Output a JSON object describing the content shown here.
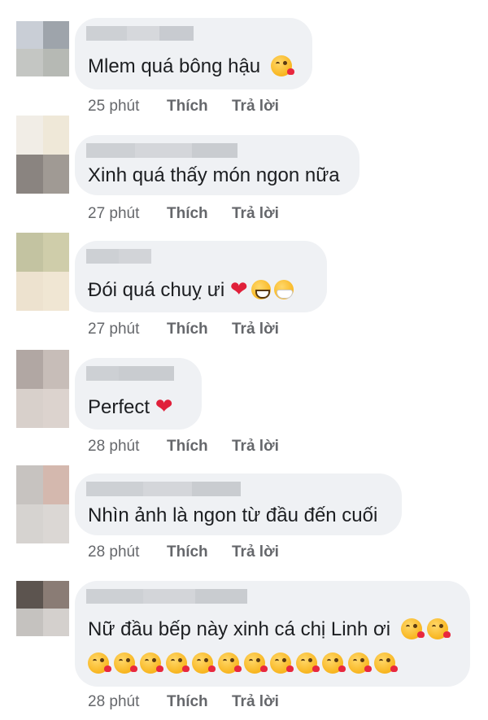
{
  "comments": [
    {
      "text": "Mlem quá bông hậu",
      "time": "25 phút",
      "like": "Thích",
      "reply": "Trả lời",
      "avatar_colors": [
        "#c9ced6",
        "#9ea4ab",
        "#c4c6c3",
        "#b6b9b4"
      ]
    },
    {
      "text": "Xinh quá thấy món ngon nữa",
      "time": "27 phút",
      "like": "Thích",
      "reply": "Trả lời",
      "avatar_colors": [
        "#f1ede6",
        "#efe8d8",
        "#8a8480",
        "#a09a94"
      ]
    },
    {
      "text": "Đói quá chuỵ ưi",
      "time": "27 phút",
      "like": "Thích",
      "reply": "Trả lời",
      "avatar_colors": [
        "#c3c3a1",
        "#cfcdaa",
        "#ede2cf",
        "#f0e6d3"
      ]
    },
    {
      "text": "Perfect",
      "time": "28 phút",
      "like": "Thích",
      "reply": "Trả lời",
      "avatar_colors": [
        "#b1a7a3",
        "#c7bdb8",
        "#d8d0cb",
        "#dcd3ce"
      ]
    },
    {
      "text": "Nhìn ảnh là ngon từ đầu đến cuối",
      "time": "28 phút",
      "like": "Thích",
      "reply": "Trả lời",
      "avatar_colors": [
        "#c7c3c0",
        "#d4b8ae",
        "#d6d3d0",
        "#dbd7d4"
      ]
    },
    {
      "text": "Nữ đầu bếp này xinh cá chị Linh ơi",
      "time": "28 phút",
      "like": "Thích",
      "reply": "Trả lời",
      "avatar_colors": [
        "#5c544f",
        "#8a7c75",
        "#f4f1ee",
        "#ece8e5"
      ]
    }
  ],
  "colors": {
    "bubble": "#eff1f4",
    "text": "#1c1e21",
    "meta": "#65676b",
    "heart": "#e0203a"
  },
  "icons": {
    "kiss": "face-blowing-kiss-emoji",
    "heart": "red-heart-emoji",
    "grin": "beaming-face-emoji",
    "mask": "face-with-medical-mask-emoji"
  }
}
